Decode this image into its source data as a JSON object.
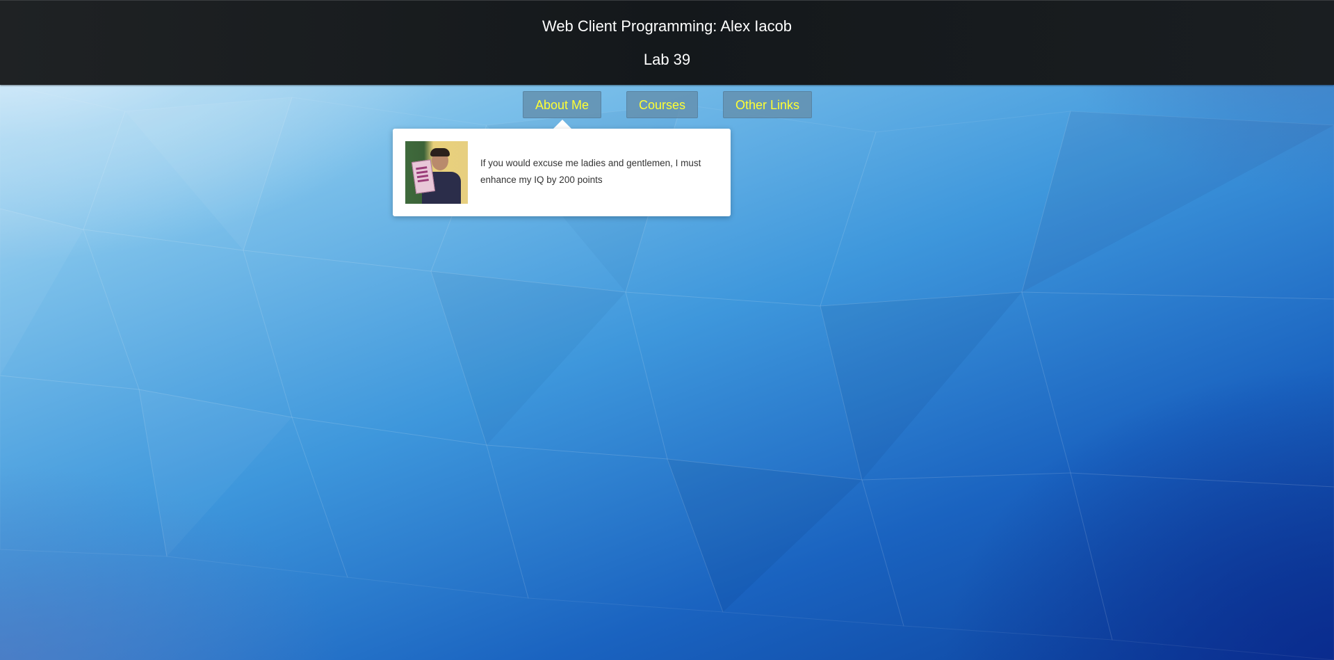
{
  "header": {
    "title": "Web Client Programming: Alex Iacob",
    "subtitle": "Lab 39"
  },
  "nav": {
    "items": [
      {
        "label": "About Me"
      },
      {
        "label": "Courses"
      },
      {
        "label": "Other Links"
      }
    ]
  },
  "about_popup": {
    "quote": "If you would excuse me ladies and gentlemen, I must enhance my IQ by 200 points"
  },
  "colors": {
    "header_bg": "#1a1e21",
    "nav_text": "#ffff33",
    "nav_bg": "#6491af",
    "popup_bg": "#ffffff"
  }
}
